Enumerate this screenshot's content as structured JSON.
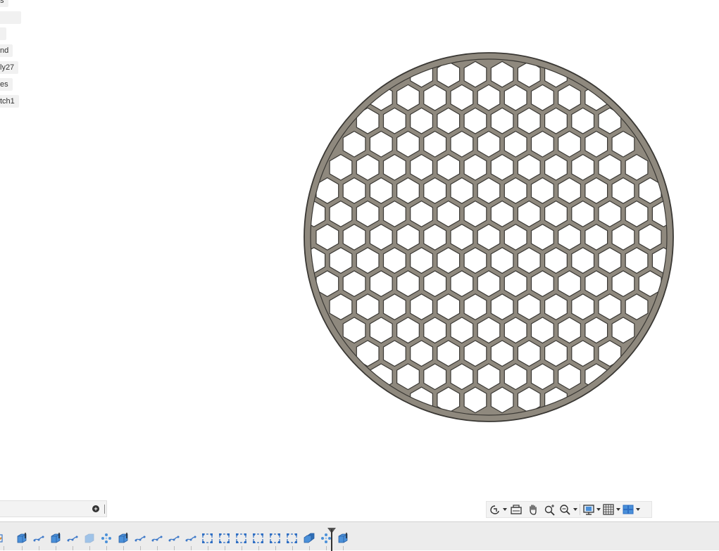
{
  "browser": {
    "items": [
      {
        "label": "s"
      },
      {
        "label": ""
      },
      {
        "label": ""
      },
      {
        "label": "nd"
      },
      {
        "label": "ly27"
      },
      {
        "label": "es"
      },
      {
        "label": "tch1"
      }
    ]
  },
  "model": {
    "shape": "circular-honeycomb-grille",
    "fill_color": "#8f897e",
    "outline_color": "#3a3834",
    "background_color": "#ffffff"
  },
  "comments": {
    "add_icon": "plus-circle-icon"
  },
  "navigation_bar": {
    "tools": [
      {
        "icon": "orbit-icon",
        "has_menu": true
      },
      {
        "icon": "look-at-icon",
        "has_menu": false
      },
      {
        "icon": "pan-hand-icon",
        "has_menu": false
      },
      {
        "icon": "zoom-icon",
        "has_menu": false
      },
      {
        "icon": "fit-zoom-icon",
        "has_menu": true
      },
      {
        "icon": "display-settings-icon",
        "has_menu": true
      },
      {
        "icon": "grid-settings-icon",
        "has_menu": true
      },
      {
        "icon": "viewports-icon",
        "has_menu": true
      }
    ]
  },
  "timeline": {
    "features": [
      "sketch",
      "extrude",
      "sketch",
      "extrude",
      "sketch",
      "fillet",
      "pattern",
      "extrude",
      "sketch",
      "sketch",
      "sketch",
      "sketch",
      "offset-plane",
      "offset-plane",
      "offset-plane",
      "offset-plane",
      "offset-plane",
      "offset-plane",
      "combine",
      "pattern",
      "extrude"
    ],
    "colors": {
      "body": "#4a90d9",
      "sketch": "#3c78c8",
      "plane": "#2f6fc4",
      "suppressed": "#9fc3e8"
    }
  }
}
